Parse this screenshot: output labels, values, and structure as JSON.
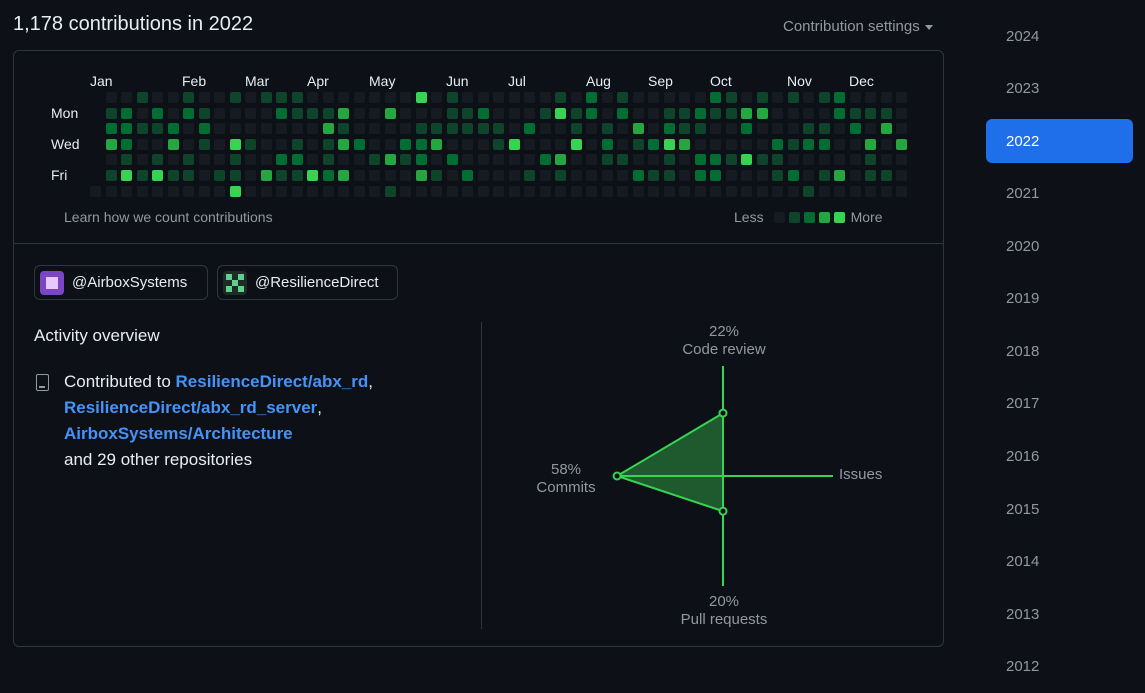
{
  "header": {
    "title": "1,178 contributions in 2022",
    "settings_label": "Contribution settings"
  },
  "calendar": {
    "months": [
      "Jan",
      "Feb",
      "Mar",
      "Apr",
      "May",
      "Jun",
      "Jul",
      "Aug",
      "Sep",
      "Oct",
      "Nov",
      "Dec"
    ],
    "day_labels": [
      "Mon",
      "Wed",
      "Fri"
    ],
    "learn_label": "Learn how we count contributions",
    "legend_less": "Less",
    "legend_more": "More",
    "level_colors": [
      "#161b22",
      "#0e4429",
      "#006d32",
      "#26a641",
      "#39d353"
    ]
  },
  "orgs": [
    {
      "handle": "@AirboxSystems"
    },
    {
      "handle": "@ResilienceDirect"
    }
  ],
  "activity": {
    "title": "Activity overview",
    "prefix": "Contributed to",
    "repo1": "ResilienceDirect/abx_rd",
    "repo2": "ResilienceDirect/abx_rd_server",
    "repo3": "AirboxSystems/Architecture",
    "others": "and 29 other repositories"
  },
  "radar": {
    "code_review_pct": "22%",
    "code_review_label": "Code review",
    "commits_pct": "58%",
    "commits_label": "Commits",
    "issues_label": "Issues",
    "pull_requests_pct": "20%",
    "pull_requests_label": "Pull requests",
    "values": {
      "code_review": 22,
      "commits": 58,
      "issues": 0,
      "pull_requests": 20
    },
    "color": "#39d353"
  },
  "years": [
    "2024",
    "2023",
    "2022",
    "2021",
    "2020",
    "2019",
    "2018",
    "2017",
    "2016",
    "2015",
    "2014",
    "2013",
    "2012"
  ],
  "selected_year": "2022"
}
